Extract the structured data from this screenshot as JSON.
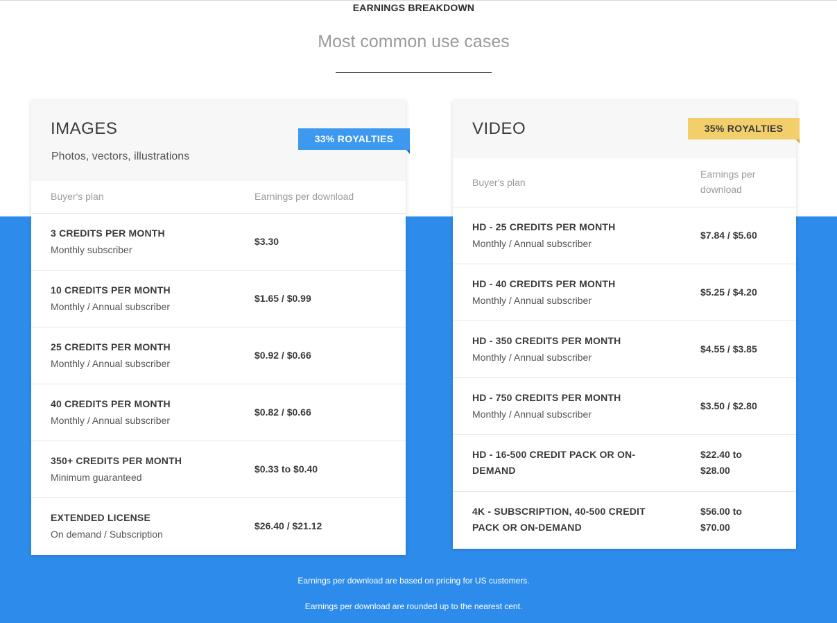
{
  "header": {
    "eyebrow": "EARNINGS BREAKDOWN",
    "headline": "Most common use cases"
  },
  "images": {
    "title": "IMAGES",
    "subtitle": "Photos, vectors, illustrations",
    "ribbon": "33% ROYALTIES",
    "ribbon_color": "#3d99f0",
    "col_plan": "Buyer's plan",
    "col_earnings": "Earnings per download",
    "rows": [
      {
        "title": "3 CREDITS PER MONTH",
        "sub": "Monthly subscriber",
        "price": "$3.30"
      },
      {
        "title": "10 CREDITS PER MONTH",
        "sub": "Monthly / Annual subscriber",
        "price": "$1.65 / $0.99"
      },
      {
        "title": "25 CREDITS PER MONTH",
        "sub": "Monthly / Annual subscriber",
        "price": "$0.92 / $0.66"
      },
      {
        "title": "40 CREDITS PER MONTH",
        "sub": "Monthly / Annual subscriber",
        "price": "$0.82 / $0.66"
      },
      {
        "title": "350+ CREDITS PER MONTH",
        "sub": "Minimum guaranteed",
        "price": "$0.33 to $0.40"
      },
      {
        "title": "EXTENDED LICENSE",
        "sub": "On demand / Subscription",
        "price": "$26.40 / $21.12"
      }
    ]
  },
  "video": {
    "title": "VIDEO",
    "ribbon": "35% ROYALTIES",
    "ribbon_color": "#f2cf6a",
    "col_plan": "Buyer's plan",
    "col_earnings": "Earnings per download",
    "rows": [
      {
        "title": "HD - 25 CREDITS PER MONTH",
        "sub": "Monthly / Annual subscriber",
        "price": "$7.84 / $5.60"
      },
      {
        "title": "HD - 40 CREDITS PER MONTH",
        "sub": "Monthly / Annual subscriber",
        "price": "$5.25 / $4.20"
      },
      {
        "title": "HD - 350 CREDITS PER MONTH",
        "sub": "Monthly / Annual subscriber",
        "price": "$4.55 / $3.85"
      },
      {
        "title": "HD - 750 CREDITS PER MONTH",
        "sub": "Monthly / Annual subscriber",
        "price": "$3.50 / $2.80"
      },
      {
        "title": "HD - 16-500 CREDIT PACK OR ON-DEMAND",
        "sub": "",
        "price": "$22.40 to $28.00"
      },
      {
        "title": "4K - SUBSCRIPTION, 40-500 CREDIT PACK OR ON-DEMAND",
        "sub": "",
        "price": "$56.00 to $70.00"
      }
    ]
  },
  "footnotes": {
    "line1": "Earnings per download are based on pricing for US customers.",
    "line2": "Earnings per download are rounded up to the nearest cent."
  },
  "colors": {
    "band": "#2d8ceb",
    "card_head": "#f7f7f7"
  }
}
